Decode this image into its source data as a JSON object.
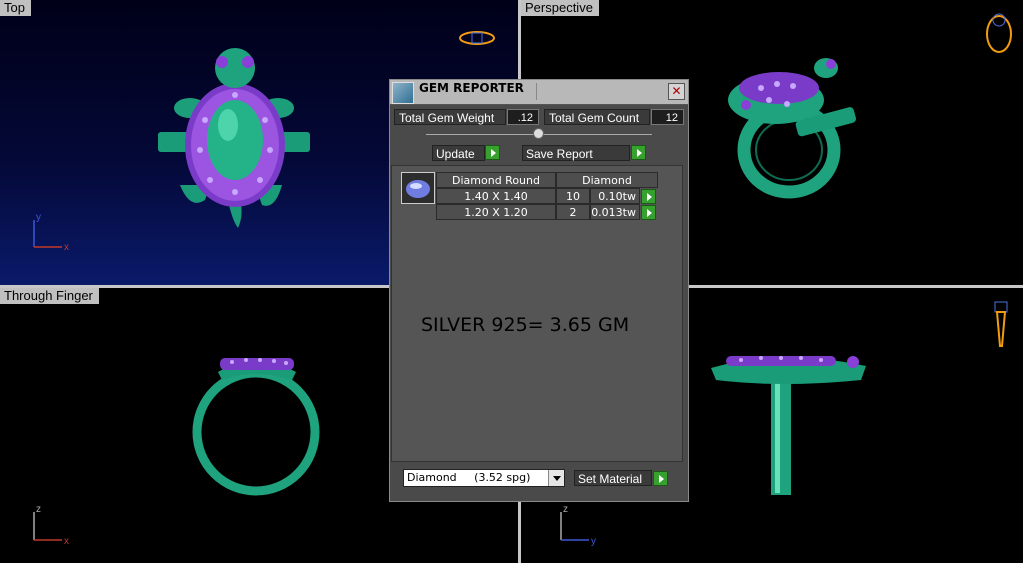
{
  "viewports": {
    "top": "Top",
    "perspective": "Perspective",
    "through_finger": "Through Finger",
    "side": ""
  },
  "axes": {
    "x": "x",
    "y": "y",
    "z": "z"
  },
  "dialog": {
    "title": "GEM REPORTER",
    "close_glyph": "✕",
    "total_weight_label": "Total Gem Weight",
    "total_weight_value": ".12",
    "total_count_label": "Total Gem Count",
    "total_count_value": "12",
    "update_label": "Update",
    "save_report_label": "Save Report",
    "table": {
      "header_shape": "Diamond Round",
      "header_material": "Diamond",
      "rows": [
        {
          "size": "1.40 X 1.40",
          "count": "10",
          "weight": "0.10tw"
        },
        {
          "size": "1.20 X 1.20",
          "count": "2",
          "weight": "0.013tw"
        }
      ]
    },
    "note": "SILVER 925= 3.65 GM",
    "material_select": "Diamond     (3.52 spg)",
    "set_material_label": "Set Material"
  },
  "colors": {
    "metal": "#1fa37e",
    "gem": "#8a3fd8",
    "accent_green": "#37a12f"
  },
  "icons": [
    "gem-reporter-icon",
    "close-icon",
    "play-icon",
    "dropdown-arrow-icon",
    "diamond-thumbnail-icon",
    "view-cube-icon"
  ]
}
